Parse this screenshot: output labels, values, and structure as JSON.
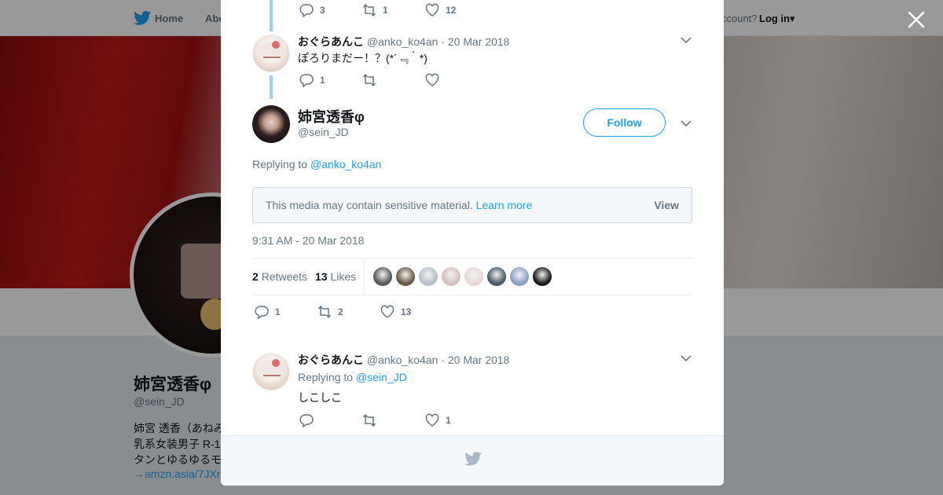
{
  "background": {
    "nav": {
      "home": "Home",
      "about": "Abo",
      "account_prompt": "ccount?",
      "login": "Log in"
    },
    "profile": {
      "name": "姉宮透香φ",
      "handle": "@sein_JD",
      "bio_lines": [
        "姉宮 透香（あねみ",
        "乳系女装男子 R-1",
        "タンとゆるゆるモ",
        "→amzn.asia/7JXr"
      ]
    }
  },
  "close_label": "×",
  "thread": [
    {
      "actions": {
        "replies": "3",
        "retweets": "1",
        "likes": "12"
      }
    },
    {
      "name": "おぐらあんこ",
      "handle": "@anko_ko4an",
      "separator": "·",
      "date": "20 Mar 2018",
      "text": "ぽろりまだー！？(*´﹃｀*)",
      "actions": {
        "replies": "1",
        "retweets": "",
        "likes": ""
      }
    }
  ],
  "main_tweet": {
    "name": "姉宮透香φ",
    "handle": "@sein_JD",
    "follow_label": "Follow",
    "replying_prefix": "Replying to",
    "replying_to": "@anko_ko4an",
    "sensitive_message": "This media may contain sensitive material.",
    "learn_more": "Learn more",
    "view_label": "View",
    "timestamp": "9:31 AM - 20 Mar 2018",
    "retweet_count": "2",
    "retweet_label": "Retweets",
    "like_count": "13",
    "like_label": "Likes",
    "likers": [
      "#5a5a5a",
      "#6b5a4a",
      "#b8c0c8",
      "#d8c0c0",
      "#e8d8d8",
      "#4a5a6a",
      "#8aa0c8",
      "#1a1a1a"
    ],
    "actions": {
      "replies": "1",
      "retweets": "2",
      "likes": "13"
    }
  },
  "reply": {
    "name": "おぐらあんこ",
    "handle": "@anko_ko4an",
    "separator": "·",
    "date": "20 Mar 2018",
    "replying_prefix": "Replying to",
    "replying_to": "@sein_JD",
    "text": "しこしこ",
    "actions": {
      "replies": "",
      "retweets": "",
      "likes": "1"
    }
  },
  "colors": {
    "accent": "#1da1f2",
    "thread_line": "#9bd1f7",
    "muted": "#657786"
  }
}
